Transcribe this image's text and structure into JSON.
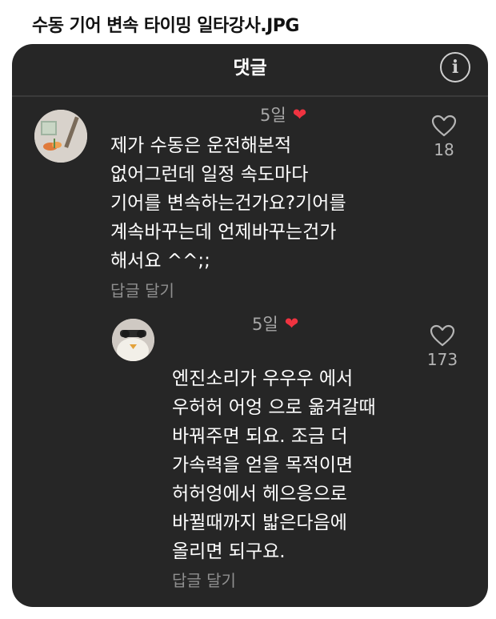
{
  "caption": "수동 기어 변속 타이밍 일타강사.JPG",
  "header": {
    "title": "댓글",
    "info_icon": "i"
  },
  "comments": [
    {
      "time": "5일",
      "body": "제가 수동은 운전해본적\n없어그런데 일정 속도마다\n기어를 변속하는건가요?기어를\n계속바꾸는데 언제바꾸는건가\n해서요 ^^;;",
      "reply": "답글 달기",
      "likes": "18"
    },
    {
      "time": "5일",
      "body": "엔진소리가 우우우 에서\n우허허 어엉 으로 옮겨갈때\n바꿔주면 되요. 조금 더\n가속력을 얻을 목적이면\n허허엉에서 헤으응으로\n바뀔때까지 밟은다음에\n올리면 되구요.",
      "reply": "답글 달기",
      "likes": "173"
    }
  ],
  "colors": {
    "panel_bg": "#262626",
    "heart": "#ef3340",
    "muted": "#a6a6a6"
  },
  "icons": {
    "liked": "heart-filled-icon",
    "like": "heart-outline-icon",
    "info": "info-icon"
  }
}
